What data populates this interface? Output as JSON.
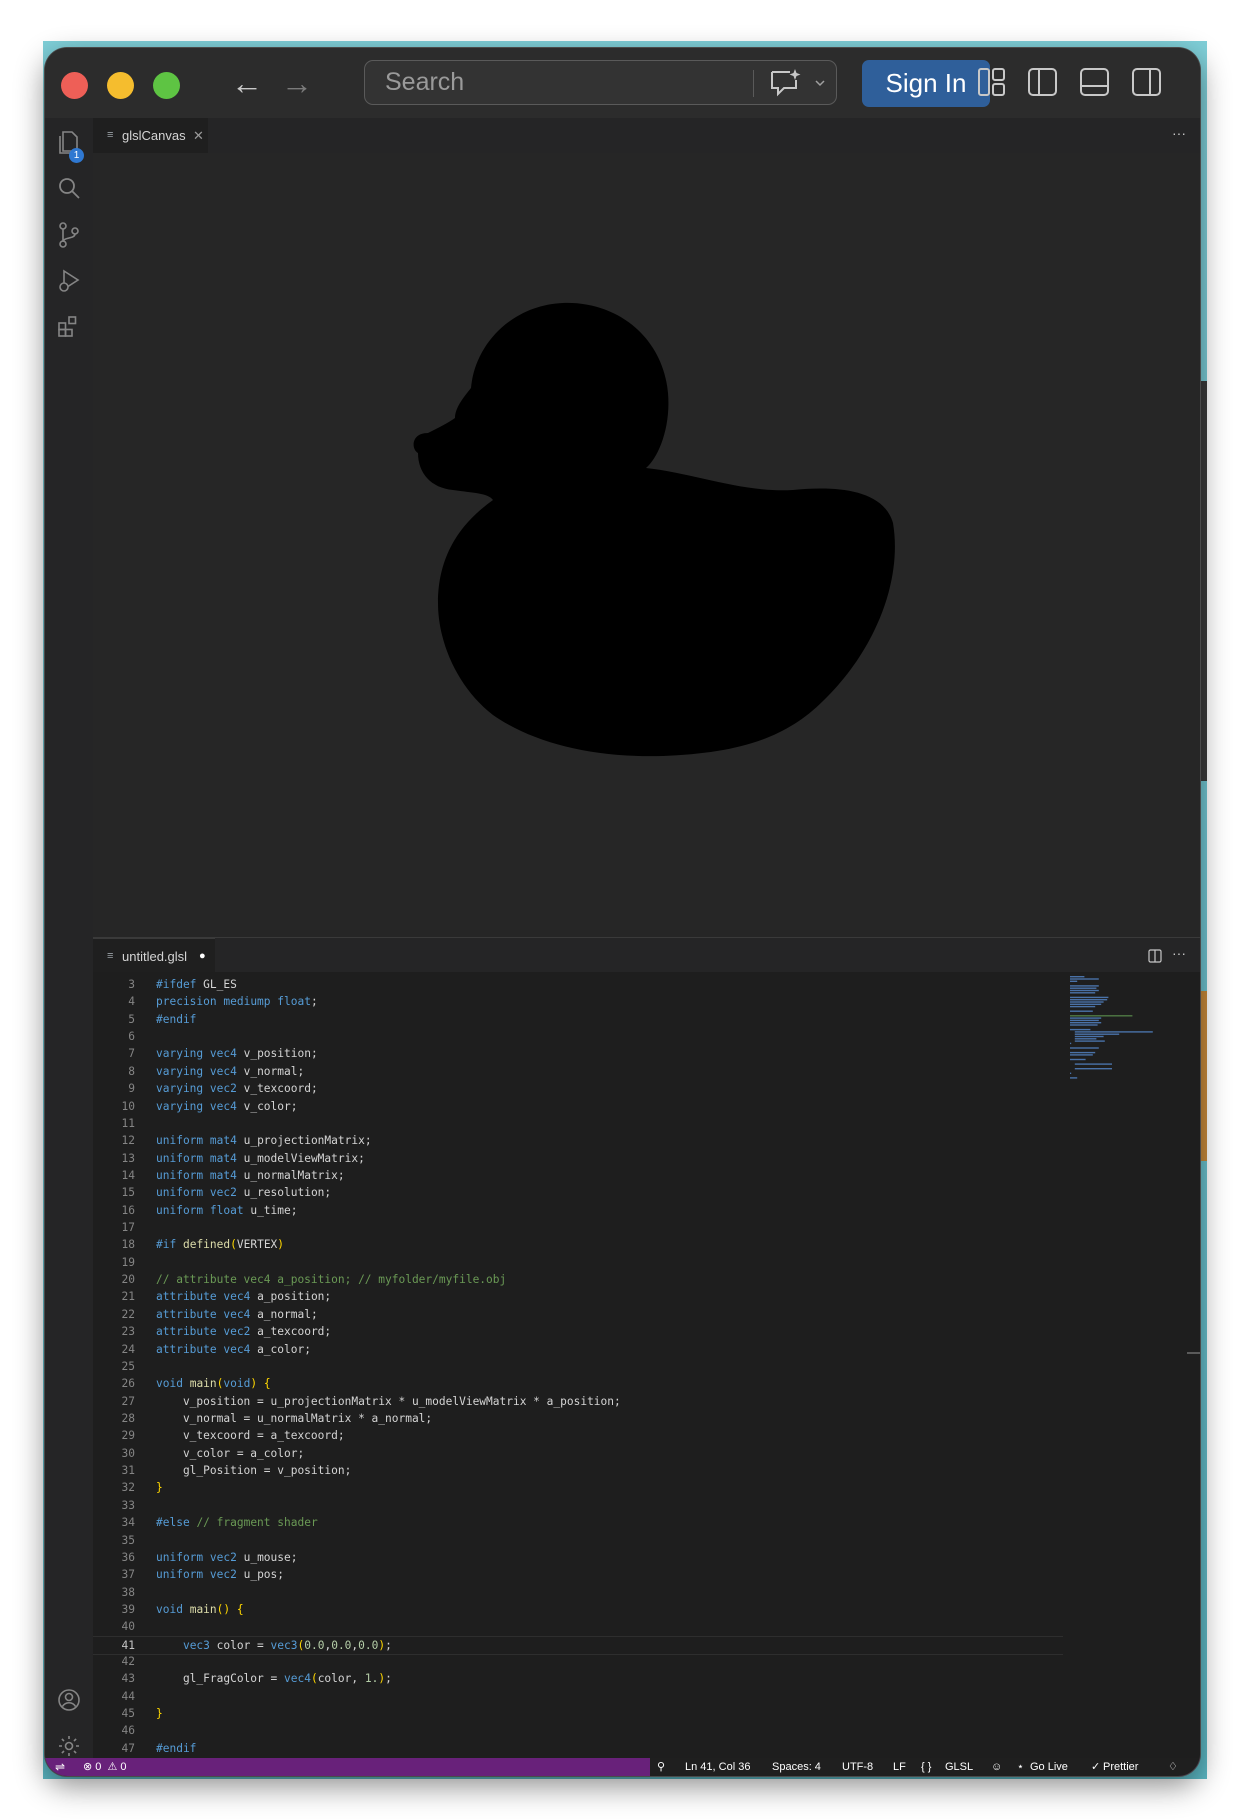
{
  "window": {
    "search_placeholder": "Search",
    "sign_in": "Sign In",
    "colors": {
      "accent": "#2f5f9a",
      "close": "#ee5f57",
      "minimize": "#f5bd2e",
      "maximize": "#5ec443",
      "statusbar": "#68217a"
    }
  },
  "activity_bar": {
    "items": [
      "explorer-icon",
      "search-icon",
      "source-control-icon",
      "run-debug-icon",
      "extensions-icon"
    ],
    "explorer_badge": "1",
    "bottom_items": [
      "accounts-icon",
      "settings-gear-icon"
    ]
  },
  "canvas_panel": {
    "tab_label": "glslCanvas",
    "more_actions": "···",
    "render_description": "black-duck-silhouette"
  },
  "editor": {
    "tab_label": "untitled.glsl",
    "dirty_marker": "●",
    "more_actions": "···",
    "lines": [
      {
        "n": "3",
        "t": "#ifdef GL_ES"
      },
      {
        "n": "4",
        "t": "precision mediump float;"
      },
      {
        "n": "5",
        "t": "#endif"
      },
      {
        "n": "6",
        "t": ""
      },
      {
        "n": "7",
        "t": "varying vec4 v_position;"
      },
      {
        "n": "8",
        "t": "varying vec4 v_normal;"
      },
      {
        "n": "9",
        "t": "varying vec2 v_texcoord;"
      },
      {
        "n": "10",
        "t": "varying vec4 v_color;"
      },
      {
        "n": "11",
        "t": ""
      },
      {
        "n": "12",
        "t": "uniform mat4 u_projectionMatrix;"
      },
      {
        "n": "13",
        "t": "uniform mat4 u_modelViewMatrix;"
      },
      {
        "n": "14",
        "t": "uniform mat4 u_normalMatrix;"
      },
      {
        "n": "15",
        "t": "uniform vec2 u_resolution;"
      },
      {
        "n": "16",
        "t": "uniform float u_time;"
      },
      {
        "n": "17",
        "t": ""
      },
      {
        "n": "18",
        "t": "#if defined(VERTEX)"
      },
      {
        "n": "19",
        "t": ""
      },
      {
        "n": "20",
        "t": "// attribute vec4 a_position; // myfolder/myfile.obj"
      },
      {
        "n": "21",
        "t": "attribute vec4 a_position;"
      },
      {
        "n": "22",
        "t": "attribute vec4 a_normal;"
      },
      {
        "n": "23",
        "t": "attribute vec2 a_texcoord;"
      },
      {
        "n": "24",
        "t": "attribute vec4 a_color;"
      },
      {
        "n": "25",
        "t": ""
      },
      {
        "n": "26",
        "t": "void main(void) {"
      },
      {
        "n": "27",
        "t": "    v_position = u_projectionMatrix * u_modelViewMatrix * a_position;"
      },
      {
        "n": "28",
        "t": "    v_normal = u_normalMatrix * a_normal;"
      },
      {
        "n": "29",
        "t": "    v_texcoord = a_texcoord;"
      },
      {
        "n": "30",
        "t": "    v_color = a_color;"
      },
      {
        "n": "31",
        "t": "    gl_Position = v_position;"
      },
      {
        "n": "32",
        "t": "}"
      },
      {
        "n": "33",
        "t": ""
      },
      {
        "n": "34",
        "t": "#else // fragment shader"
      },
      {
        "n": "35",
        "t": ""
      },
      {
        "n": "36",
        "t": "uniform vec2 u_mouse;"
      },
      {
        "n": "37",
        "t": "uniform vec2 u_pos;"
      },
      {
        "n": "38",
        "t": ""
      },
      {
        "n": "39",
        "t": "void main() {"
      },
      {
        "n": "40",
        "t": ""
      },
      {
        "n": "41",
        "t": "    vec3 color = vec3(0.0,0.0,0.0);"
      },
      {
        "n": "42",
        "t": ""
      },
      {
        "n": "43",
        "t": "    gl_FragColor = vec4(color, 1.);"
      },
      {
        "n": "44",
        "t": ""
      },
      {
        "n": "45",
        "t": "}"
      },
      {
        "n": "46",
        "t": ""
      },
      {
        "n": "47",
        "t": "#endif"
      }
    ],
    "current_line": "41"
  },
  "status_bar": {
    "errors": "0",
    "warnings": "0",
    "position": "Ln 41, Col 36",
    "spaces": "Spaces: 4",
    "encoding": "UTF-8",
    "eol": "LF",
    "language": "GLSL",
    "go_live": "Go Live",
    "prettier": "Prettier"
  }
}
